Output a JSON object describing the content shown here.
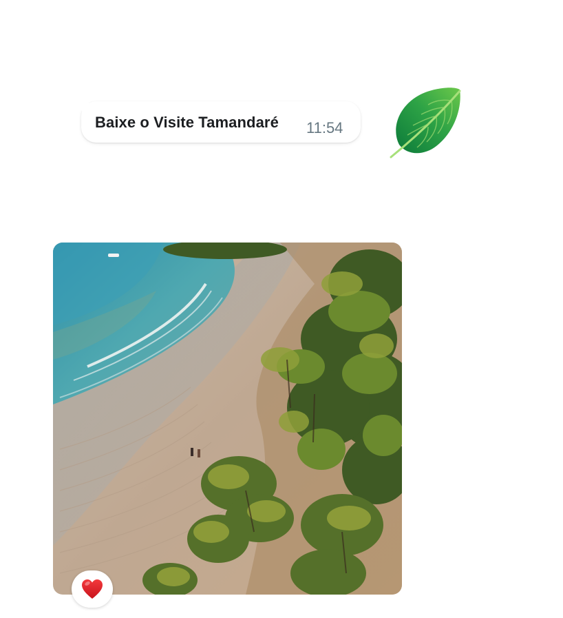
{
  "message": {
    "text": "Baixe o Visite Tamandaré",
    "time": "11:54"
  },
  "sticker": {
    "icon": "leaf-icon",
    "color": "#2e9b3c"
  },
  "photo": {
    "icon": "beach-photo"
  },
  "reaction": {
    "icon": "heart-icon",
    "color": "#e0242a"
  }
}
